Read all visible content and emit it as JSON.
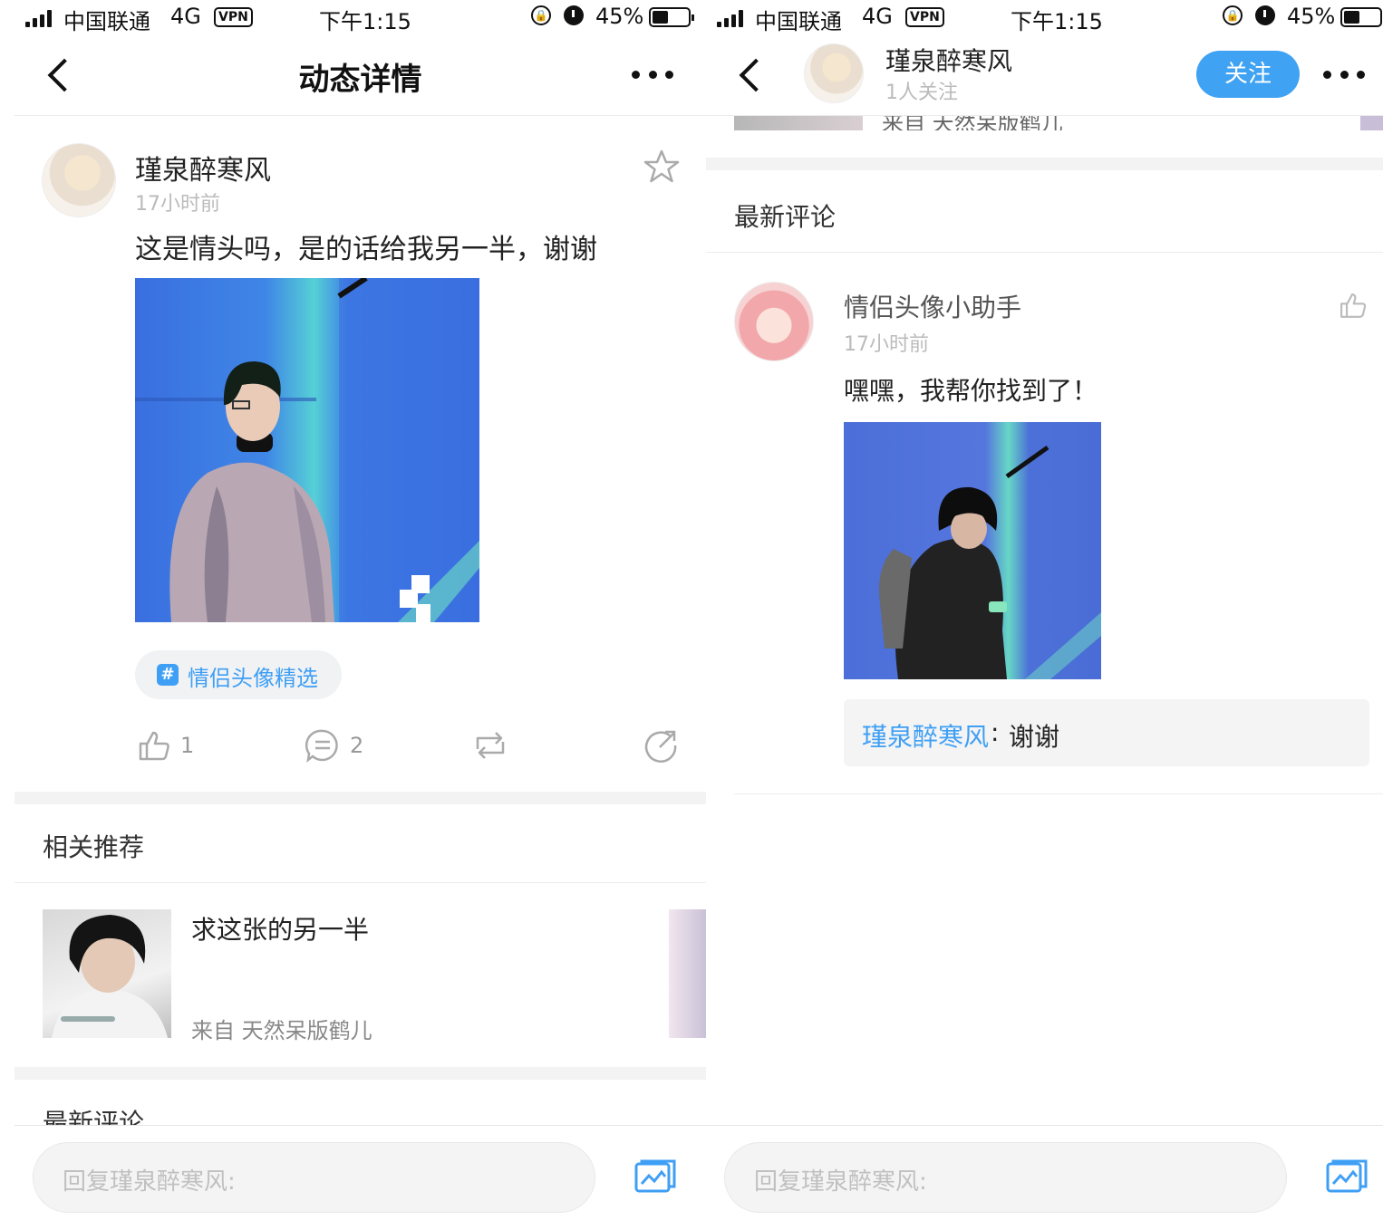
{
  "status": {
    "carrier": "中国联通",
    "network": "4G",
    "vpn": "VPN",
    "time": "下午1:15",
    "lock_glyph": "🔒",
    "battery_text": "45%",
    "battery_level": 0.45
  },
  "left": {
    "nav_title": "动态详情",
    "post": {
      "user": "瑾泉醉寒风",
      "time": "17小时前",
      "text": "这是情头吗，是的话给我另一半，谢谢",
      "topic_hash": "#",
      "topic": "情侣头像精选",
      "like_count": "1",
      "comment_count": "2"
    },
    "related_title": "相关推荐",
    "related_item": {
      "title": "求这张的另一半",
      "from": "来自 天然呆版鹤儿"
    },
    "latest_comments_title": "最新评论",
    "reply_placeholder": "回复瑾泉醉寒风:"
  },
  "right": {
    "nav_user": "瑾泉醉寒风",
    "follow_count": "1人关注",
    "follow_button": "关注",
    "strip_from": "来自 天然呆版鹤儿",
    "latest_comments_title": "最新评论",
    "comment": {
      "user": "情侣头像小助手",
      "time": "17小时前",
      "text": "嘿嘿，我帮你找到了！",
      "reply_user": "瑾泉醉寒风",
      "reply_colon": ":",
      "reply_text": "谢谢"
    },
    "reply_placeholder": "回复瑾泉醉寒风:"
  },
  "icons": {
    "back": "chevron-left-icon",
    "more": "more-dots-icon",
    "star": "star-icon",
    "like": "thumbs-up-icon",
    "comment": "comment-icon",
    "repost": "repost-icon",
    "share": "share-icon",
    "image": "image-icon"
  },
  "colors": {
    "accent": "#3f9ff5",
    "follow_bg": "#3fa2f2",
    "separator": "#f3f3f3"
  }
}
